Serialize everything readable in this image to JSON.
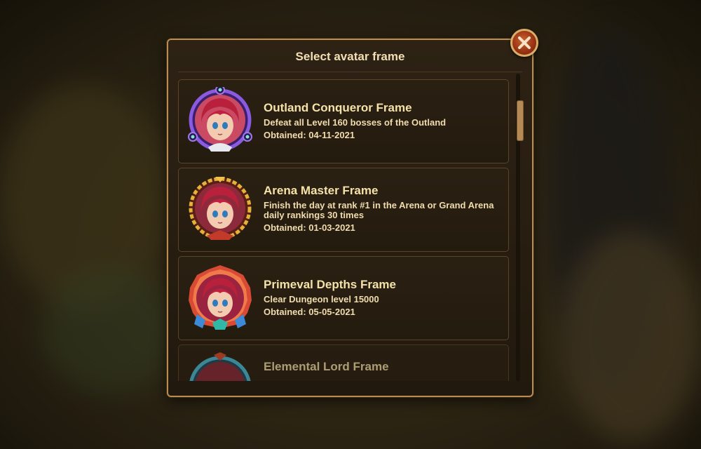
{
  "dialog": {
    "title": "Select avatar frame"
  },
  "frames": [
    {
      "name": "Outland Conqueror Frame",
      "description": "Defeat all Level 160 bosses of the Outland",
      "obtained": "Obtained: 04-11-2021",
      "frame_color": "#7b4ad6"
    },
    {
      "name": "Arena Master Frame",
      "description": "Finish the day at rank #1 in the Arena or Grand Arena daily rankings 30 times",
      "obtained": "Obtained: 01-03-2021",
      "frame_color": "#d6a52a"
    },
    {
      "name": "Primeval Depths Frame",
      "description": "Clear Dungeon level 15000",
      "obtained": "Obtained: 05-05-2021",
      "frame_color": "#e05a3a"
    },
    {
      "name": "Elemental Lord Frame",
      "description": "",
      "obtained": "",
      "frame_color": "#3aa0c8"
    }
  ],
  "colors": {
    "accent": "#b98c52",
    "text": "#f5e2a9",
    "close": "#9b3414"
  },
  "icons": {
    "close": "close-icon"
  }
}
